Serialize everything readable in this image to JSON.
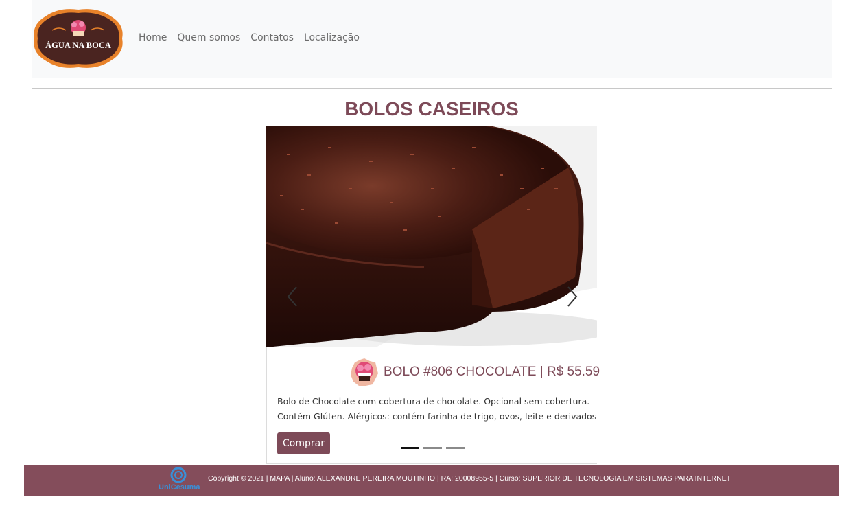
{
  "brand": {
    "name": "ÁGUA NA BOCA",
    "colors": {
      "primary": "#7d4a58",
      "footer": "#844d5b",
      "logo_bg": "#4a2420",
      "logo_ring": "#e8822a"
    }
  },
  "nav": {
    "items": [
      {
        "label": "Home"
      },
      {
        "label": "Quem somos"
      },
      {
        "label": "Contatos"
      },
      {
        "label": "Localização"
      }
    ]
  },
  "section": {
    "title": "BOLOS CASEIROS"
  },
  "carousel": {
    "active_index": 0,
    "slide_count": 3,
    "product": {
      "title": "BOLO #806 CHOCOLATE | R$ 55.59",
      "description_line1": "Bolo de Chocolate com cobertura de chocolate. Opcional sem cobertura.",
      "description_line2": "Contém Glúten. Alérgicos: contém farinha de trigo, ovos, leite e derivados",
      "buy_label": "Comprar",
      "image_icon": "chocolate-cake-photo"
    },
    "prev_icon": "chevron-left-icon",
    "next_icon": "chevron-right-icon"
  },
  "footer": {
    "logo_text": "UniCesumar",
    "text": "Copyright © 2021 | MAPA | Aluno: ALEXANDRE PEREIRA MOUTINHO | RA: 20008955-5 | Curso: SUPERIOR DE TECNOLOGIA EM SISTEMAS PARA INTERNET"
  }
}
